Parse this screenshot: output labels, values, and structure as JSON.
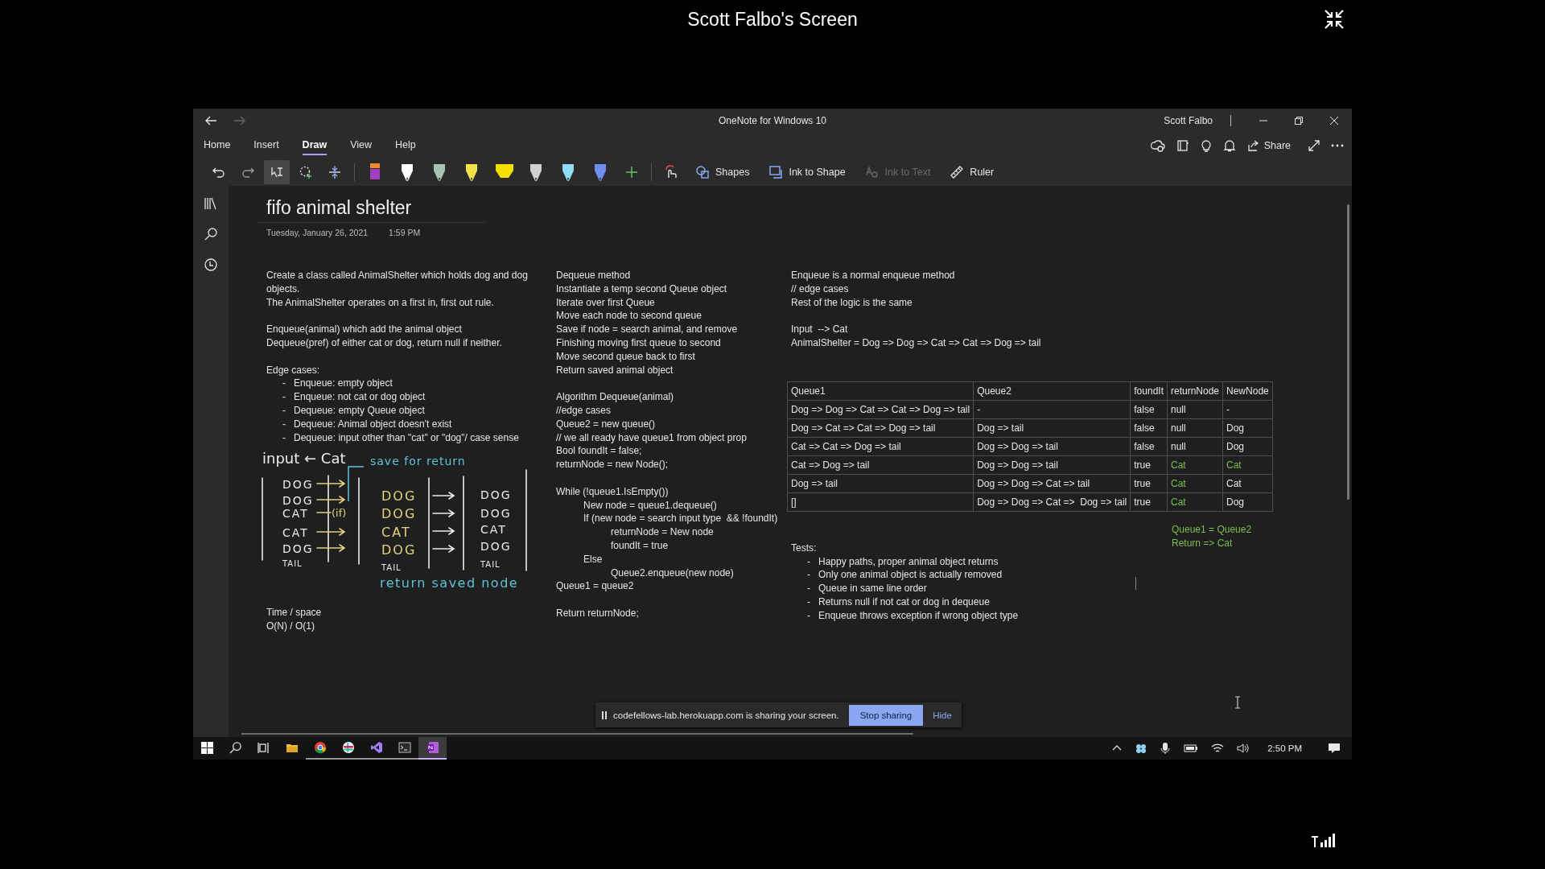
{
  "screen_title": "Scott Falbo's Screen",
  "window": {
    "title": "OneNote for Windows 10",
    "user": "Scott Falbo",
    "back": {
      "disabled": false
    },
    "forward": {
      "disabled": true
    }
  },
  "menu_tabs": [
    {
      "label": "Home",
      "selected": false
    },
    {
      "label": "Insert",
      "selected": false
    },
    {
      "label": "Draw",
      "selected": true
    },
    {
      "label": "View",
      "selected": false
    },
    {
      "label": "Help",
      "selected": false
    }
  ],
  "share_label": "Share",
  "toolbar": {
    "tools": [
      {
        "kind": "undo",
        "selected": false
      },
      {
        "kind": "redo",
        "selected": false
      },
      {
        "kind": "lasso",
        "selected": true
      },
      {
        "kind": "addlasso",
        "selected": false
      },
      {
        "kind": "space",
        "selected": false
      }
    ],
    "pens": [
      {
        "kind": "marker",
        "color": "#a23fc0"
      },
      {
        "kind": "pen",
        "color": "#ffffff"
      },
      {
        "kind": "pen",
        "color": "#a9c4ae"
      },
      {
        "kind": "pen",
        "color": "#f2e24a"
      },
      {
        "kind": "highlighter",
        "color": "#f4e000"
      },
      {
        "kind": "pen",
        "color": "#d0d0d0"
      },
      {
        "kind": "pen",
        "color": "#8fdcf4"
      },
      {
        "kind": "pen",
        "color": "#6f8ff0"
      }
    ],
    "actions": [
      {
        "kind": "shapes",
        "label": "Shapes",
        "disabled": false
      },
      {
        "kind": "inkshape",
        "label": "Ink to Shape",
        "disabled": false
      },
      {
        "kind": "inktext",
        "label": "Ink to Text",
        "disabled": true
      },
      {
        "kind": "ruler",
        "label": "Ruler",
        "disabled": false
      }
    ]
  },
  "page": {
    "title": "fifo animal shelter",
    "date": "Tuesday, January 26, 2021",
    "time": "1:59 PM",
    "column_1": [
      {
        "kind": "text",
        "lines": [
          "Create a class called AnimalShelter which holds dog and dog objects.",
          "The AnimalShelter operates on a first in, first out rule."
        ]
      },
      {
        "kind": "text",
        "lines": [
          "Enqueue(animal) which add the animal object",
          "Dequeue(pref) of either cat or dog, return null if neither."
        ]
      },
      {
        "kind": "list",
        "heading": "Edge cases:",
        "items": [
          {
            "marker": "-",
            "text": "Enqueue: empty object"
          },
          {
            "marker": "-",
            "text": "Enqueue: not cat or dog object"
          },
          {
            "marker": "-",
            "text": "Dequeue: empty Queue object"
          },
          {
            "marker": "-",
            "text": "Dequeue: Animal object doesn't exist"
          },
          {
            "marker": "-",
            "text": "Dequeue: input other than \"cat\" or \"dog\"/ case sense"
          }
        ]
      },
      {
        "kind": "ink",
        "heading": "input ← Cat",
        "top_note": "save for return",
        "condition": "(if)",
        "bottom_note": "return saved node",
        "stacks": [
          {
            "color": "#ececec",
            "items": [
              "DOG",
              "DOG",
              "CAT",
              "CAT",
              "DOG"
            ],
            "tail": "TAIL"
          },
          {
            "color": "#e2d27c",
            "items": [
              "DOG",
              "DOG",
              "CAT",
              "DOG"
            ],
            "tail": "TAIL"
          },
          {
            "color": "#ececec",
            "items": [
              "DOG",
              "DOG",
              "CAT",
              "DOG"
            ],
            "tail": "TAIL"
          }
        ]
      },
      {
        "kind": "text",
        "lines": [
          "Time / space",
          "O(N) / O(1)"
        ]
      }
    ],
    "column_2": [
      {
        "kind": "text",
        "lines": [
          "Dequeue method",
          "Instantiate a temp second Queue object",
          "Iterate over first Queue",
          "Move each node to second queue",
          "Save if node = search animal, and remove",
          "Finishing moving first queue to second",
          "Move second queue back to first",
          "Return saved animal object"
        ]
      },
      {
        "kind": "text",
        "lines": [
          "Algorithm Dequeue(animal)",
          "//edge cases",
          "Queue2 = new queue()",
          "// we all ready have queue1 from object prop",
          "Bool foundIt = false;",
          "returnNode = new Node();"
        ]
      },
      {
        "kind": "code",
        "lines": [
          {
            "text": "While (!queue1.IsEmpty())",
            "children": [
              {
                "text": "New node = queue1.dequeue()"
              },
              {
                "text": "If (new node = search input type  && !foundIt)",
                "children": [
                  {
                    "text": "returnNode = New node"
                  },
                  {
                    "text": "foundIt = true"
                  }
                ]
              },
              {
                "text": "Else",
                "children": [
                  {
                    "text": "Queue2.enqueue(new node)"
                  }
                ]
              }
            ]
          },
          {
            "text": "Queue1 = queue2"
          }
        ]
      },
      {
        "kind": "text",
        "lines": [
          "Return returnNode;"
        ]
      }
    ],
    "column_3": [
      {
        "kind": "text",
        "lines": [
          "Enqueue is a normal enqueue method",
          "// edge cases",
          "Rest of the logic is the same"
        ]
      },
      {
        "kind": "text",
        "lines": [
          "Input  --> Cat",
          "AnimalShelter = Dog => Dog => Cat => Cat => Dog => tail"
        ]
      }
    ],
    "table": {
      "columns": [
        "Queue1",
        "Queue2",
        "foundIt",
        "returnNode",
        "NewNode"
      ],
      "rows": [
        {
          "cells": [
            {
              "text": "Dog => Dog => Cat => Cat => Dog => tail",
              "highlighted": false
            },
            {
              "text": "-",
              "highlighted": false
            },
            {
              "text": "false",
              "highlighted": false
            },
            {
              "text": "null",
              "highlighted": false
            },
            {
              "text": "-",
              "highlighted": false
            }
          ]
        },
        {
          "cells": [
            {
              "text": "Dog => Cat => Cat => Dog => tail",
              "highlighted": false
            },
            {
              "text": "Dog => tail",
              "highlighted": false
            },
            {
              "text": "false",
              "highlighted": false
            },
            {
              "text": "null",
              "highlighted": false
            },
            {
              "text": "Dog",
              "highlighted": false
            }
          ]
        },
        {
          "cells": [
            {
              "text": "Cat => Cat => Dog => tail",
              "highlighted": false
            },
            {
              "text": "Dog => Dog => tail",
              "highlighted": false
            },
            {
              "text": "false",
              "highlighted": false
            },
            {
              "text": "null",
              "highlighted": false
            },
            {
              "text": "Dog",
              "highlighted": false
            }
          ]
        },
        {
          "cells": [
            {
              "text": "Cat => Dog => tail",
              "highlighted": false
            },
            {
              "text": "Dog => Dog => tail",
              "highlighted": false
            },
            {
              "text": "true",
              "highlighted": false
            },
            {
              "text": "Cat",
              "highlighted": true
            },
            {
              "text": "Cat",
              "highlighted": true
            }
          ]
        },
        {
          "cells": [
            {
              "text": "Dog => tail",
              "highlighted": false
            },
            {
              "text": "Dog => Dog => Cat => tail",
              "highlighted": false
            },
            {
              "text": "true",
              "highlighted": false
            },
            {
              "text": "Cat",
              "highlighted": true
            },
            {
              "text": "Cat",
              "highlighted": false
            }
          ]
        },
        {
          "cells": [
            {
              "text": "[]",
              "highlighted": false
            },
            {
              "text": "Dog => Dog => Cat =>  Dog => tail",
              "highlighted": false
            },
            {
              "text": "true",
              "highlighted": false
            },
            {
              "text": "Cat",
              "highlighted": true
            },
            {
              "text": "Dog",
              "highlighted": false
            }
          ]
        }
      ]
    },
    "note": [
      "Queue1 = Queue2",
      "Return => Cat"
    ],
    "tests": {
      "heading": "Tests:",
      "items": [
        {
          "marker": "-",
          "text": "Happy paths, proper animal object returns"
        },
        {
          "marker": "-",
          "text": "Only one animal object is actually removed"
        },
        {
          "marker": "-",
          "text": "Queue in same line order"
        },
        {
          "marker": "-",
          "text": "Returns null if not cat or dog in dequeue"
        },
        {
          "marker": "-",
          "text": "Enqueue throws exception if wrong object type"
        }
      ]
    }
  },
  "sharing_banner": {
    "message": "codefellows-lab.herokuapp.com is sharing your screen.",
    "stop_label": "Stop sharing",
    "hide_label": "Hide"
  },
  "taskbar": {
    "buttons": [
      {
        "kind": "start"
      },
      {
        "kind": "search"
      },
      {
        "kind": "taskview"
      }
    ],
    "apps": [
      {
        "kind": "explorer",
        "running": false,
        "selected": false
      },
      {
        "kind": "chrome",
        "running": true,
        "selected": false
      },
      {
        "kind": "slack",
        "running": true,
        "selected": false
      },
      {
        "kind": "studio",
        "running": true,
        "selected": false
      },
      {
        "kind": "terminal",
        "running": true,
        "selected": false
      },
      {
        "kind": "onenote",
        "running": true,
        "selected": true
      }
    ],
    "tray": [
      {
        "kind": "chevron"
      },
      {
        "kind": "cloud"
      },
      {
        "kind": "mic"
      },
      {
        "kind": "battery"
      },
      {
        "kind": "wifi"
      },
      {
        "kind": "speaker"
      }
    ],
    "time": "2:50 PM"
  }
}
